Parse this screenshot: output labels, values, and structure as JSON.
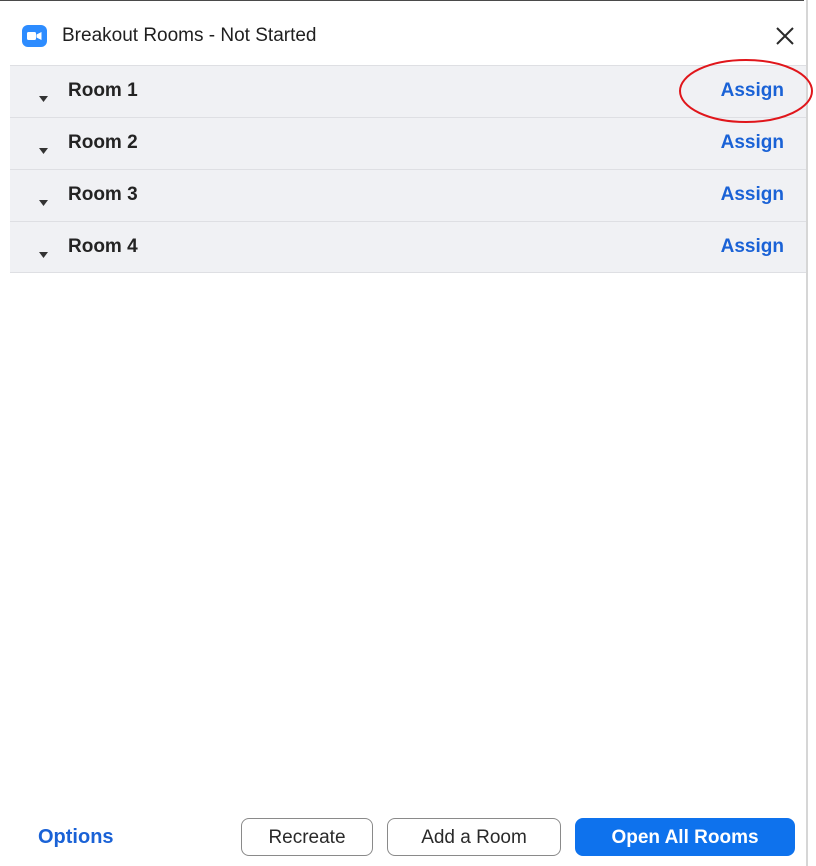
{
  "window": {
    "title": "Breakout Rooms - Not Started",
    "app_icon": "zoom-camera-icon",
    "close_icon": "close-icon"
  },
  "rooms": [
    {
      "label": "Room 1",
      "action": "Assign",
      "highlighted": true
    },
    {
      "label": "Room 2",
      "action": "Assign",
      "highlighted": false
    },
    {
      "label": "Room 3",
      "action": "Assign",
      "highlighted": false
    },
    {
      "label": "Room 4",
      "action": "Assign",
      "highlighted": false
    }
  ],
  "footer": {
    "options_label": "Options",
    "recreate_label": "Recreate",
    "add_room_label": "Add a Room",
    "open_all_label": "Open All Rooms"
  },
  "colors": {
    "accent": "#0e72ed",
    "link": "#1a62d6",
    "row_background": "#f0f1f4",
    "annotation": "#e0161b"
  }
}
